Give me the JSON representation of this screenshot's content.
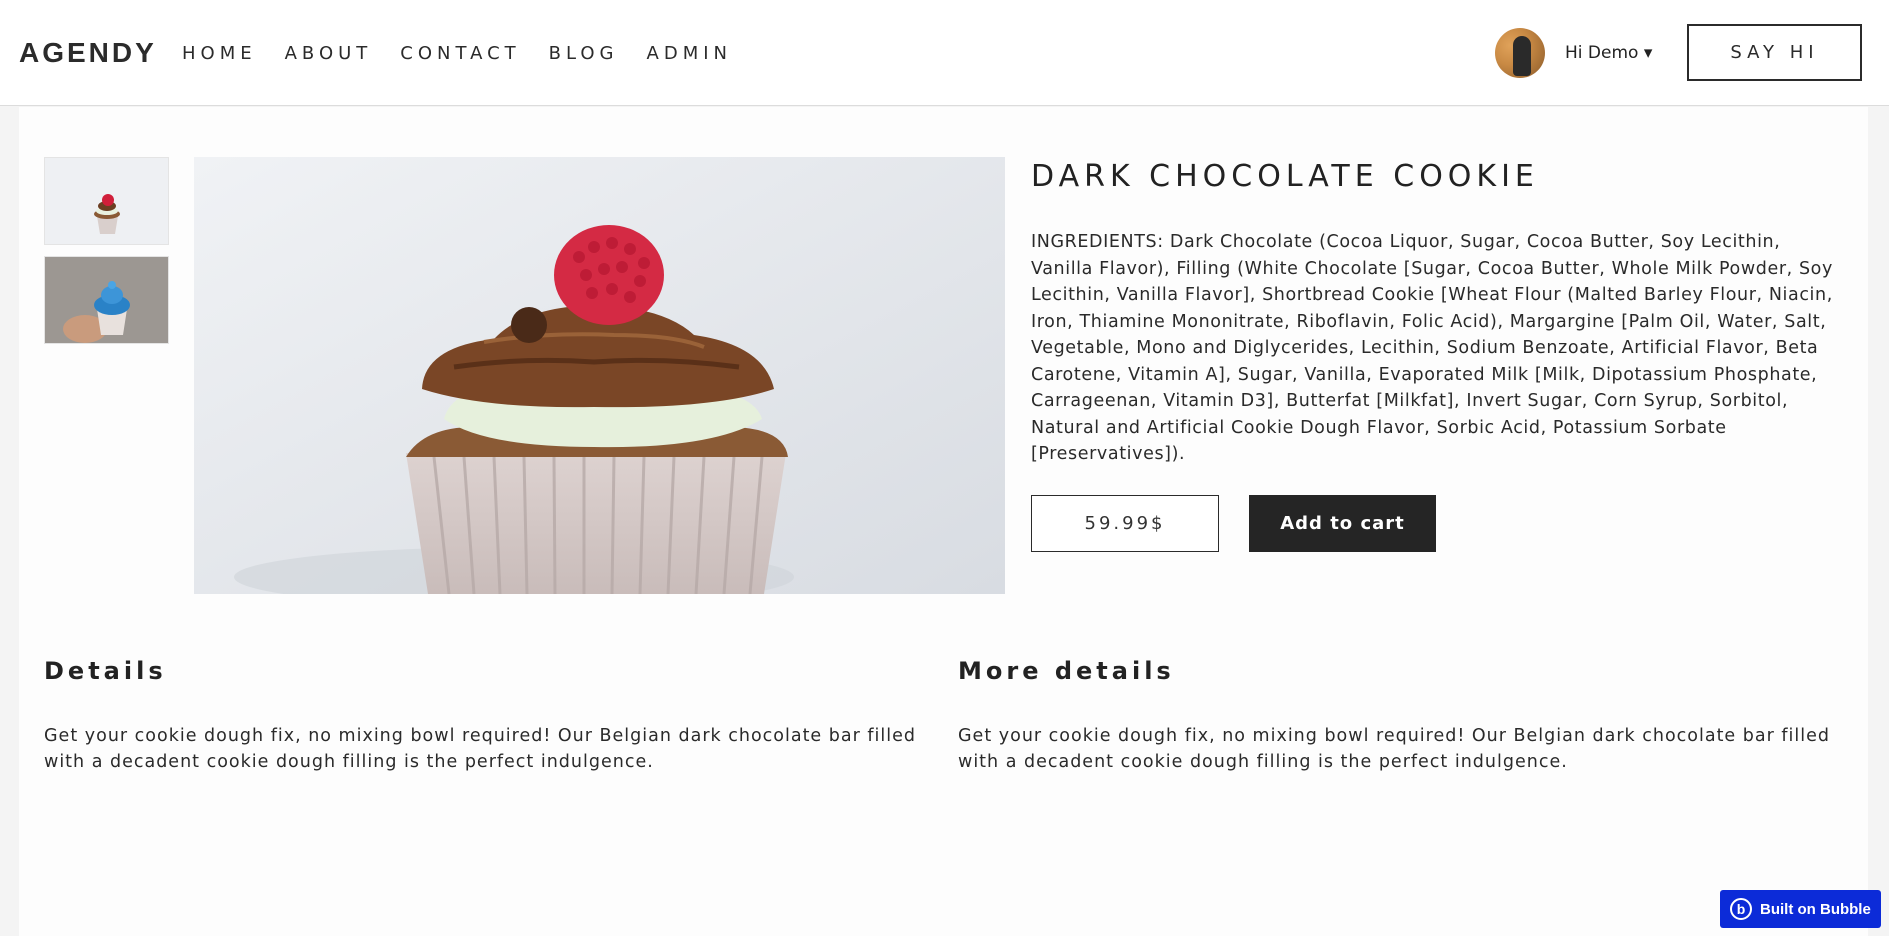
{
  "header": {
    "logo": "AGENDY",
    "nav": [
      "HOME",
      "ABOUT",
      "CONTACT",
      "BLOG",
      "ADMIN"
    ],
    "user_greeting": "Hi Demo ▾",
    "say_hi": "SAY HI"
  },
  "product": {
    "title": "DARK CHOCOLATE COOKIE",
    "ingredients": "INGREDIENTS: Dark Chocolate (Cocoa Liquor, Sugar, Cocoa Butter, Soy Lecithin, Vanilla Flavor), Filling (White Chocolate [Sugar, Cocoa Butter, Whole Milk Powder, Soy Lecithin, Vanilla Flavor], Shortbread Cookie [Wheat Flour (Malted Barley Flour, Niacin, Iron, Thiamine Mononitrate, Riboflavin, Folic Acid), Margargine [Palm Oil, Water, Salt, Vegetable, Mono and Diglycerides, Lecithin, Sodium Benzoate, Artificial Flavor, Beta Carotene, Vitamin A], Sugar, Vanilla, Evaporated Milk [Milk, Dipotassium Phosphate, Carrageenan, Vitamin D3], Butterfat [Milkfat], Invert Sugar, Corn Syrup, Sorbitol, Natural and Artificial Cookie Dough Flavor, Sorbic Acid, Potassium Sorbate [Preservatives]).",
    "price": "59.99$",
    "add_to_cart": "Add to cart"
  },
  "details": {
    "title": "Details",
    "text": "Get your cookie dough fix, no mixing bowl required!  Our Belgian dark chocolate bar filled with a decadent cookie dough filling is the perfect indulgence."
  },
  "more_details": {
    "title": "More details",
    "text": "Get your cookie dough fix, no mixing bowl required!  Our Belgian dark chocolate bar filled with a decadent cookie dough filling is the perfect indulgence."
  },
  "badge": {
    "label": "Built on Bubble"
  },
  "colors": {
    "accent_dark": "#252525",
    "bubble_blue": "#0c2bd8"
  }
}
